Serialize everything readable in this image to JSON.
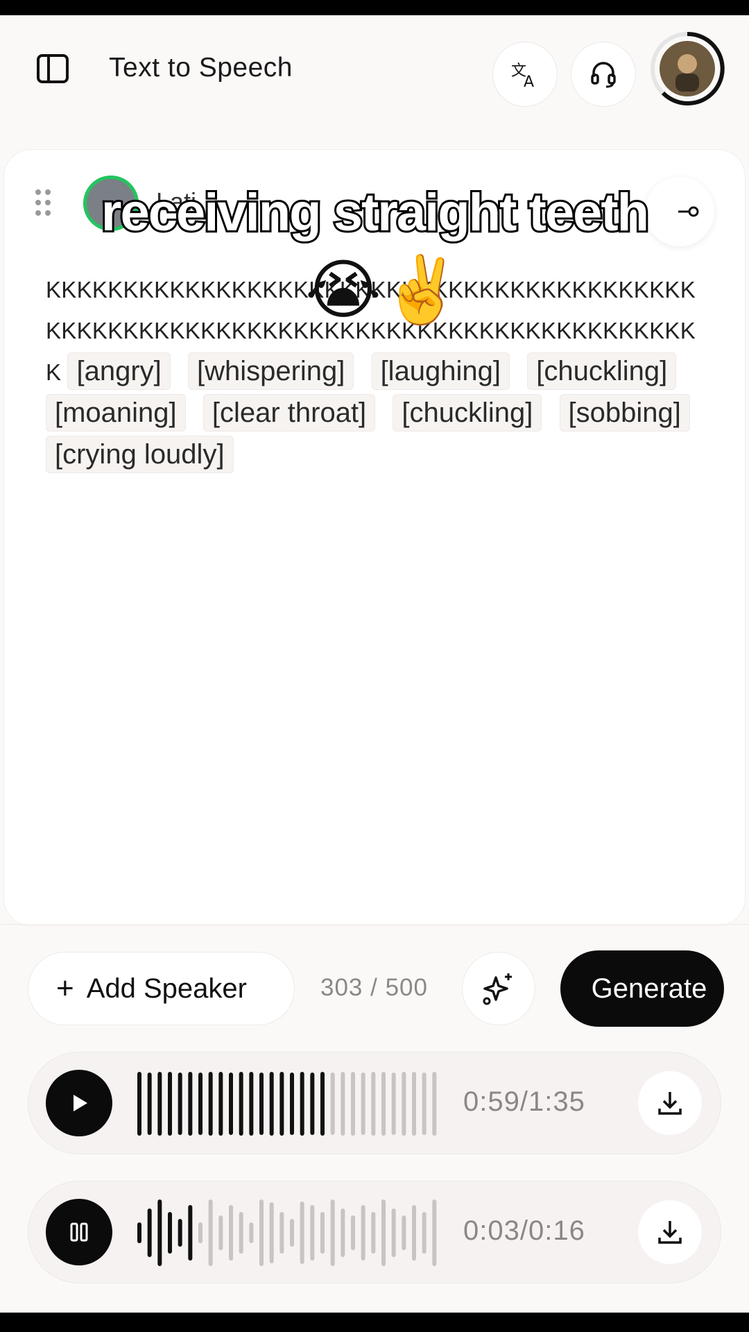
{
  "header": {
    "title": "Text to Speech",
    "icons": [
      "sidebar-toggle-icon",
      "translate-icon",
      "headset-icon",
      "avatar"
    ]
  },
  "speaker": {
    "name": "Lati",
    "status_color": "#22c55e"
  },
  "script": {
    "text_runs": [
      "KKKKKKKKKKKKKKKKKKKKKKKKKKKKKKKKKKKKKKKKKKKKKKKKKKKKKKKKKKKKKKKKKKKKKKKKKKKKKKKKKKKKK"
    ],
    "tags": [
      "[angry]",
      "[whispering]",
      "[laughing]",
      "[chuckling]",
      "[moaning]",
      "[clear throat]",
      "[chuckling]",
      "[sobbing]",
      "[crying loudly]"
    ]
  },
  "caption": {
    "text": "receiving straight teeth",
    "emoji": "😭✌️"
  },
  "controls": {
    "add_speaker_label": "Add Speaker",
    "char_count": "303 / 500",
    "generate_label": "Generate"
  },
  "players": [
    {
      "state": "paused",
      "time": "0:59/1:35",
      "progress": 0.62
    },
    {
      "state": "playing",
      "time": "0:03/0:16",
      "progress": 0.19
    }
  ],
  "colors": {
    "accent": "#0b0b0b",
    "background": "#fbf9f8",
    "muted_text": "#8a8785"
  }
}
